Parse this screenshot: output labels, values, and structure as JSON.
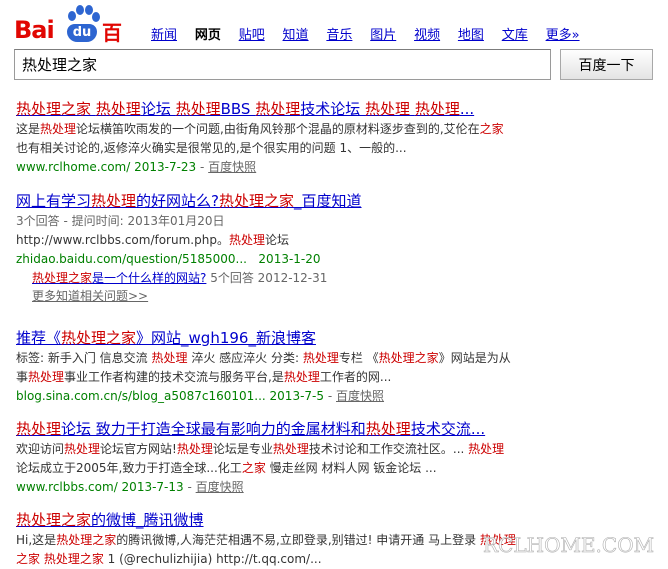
{
  "logo": {
    "bai": "Bai",
    "du": "du",
    "baidu_cn": "百度"
  },
  "nav": [
    "新闻",
    "网页",
    "贴吧",
    "知道",
    "音乐",
    "图片",
    "视频",
    "地图",
    "文库",
    "更多»"
  ],
  "nav_current": "网页",
  "search": {
    "query": "热处理之家",
    "button_label": "百度一下"
  },
  "results": [
    {
      "title": [
        "热处理之家",
        " ",
        "热处理",
        "论坛 ",
        "热处理",
        "BBS ",
        "热处理",
        "技术论坛 ",
        "热处理",
        " ",
        "热处理",
        "..."
      ],
      "abstract_line1": [
        "这是",
        "热处理",
        "论坛横笛吹雨发的一个问题,由街角风铃那个混晶的原材料逐步查到的,艾伦在",
        "之家"
      ],
      "abstract_line2": "也有相关讨论的,返修淬火确实是很常见的,是个很实用的问题 1、一般的...",
      "url": "www.rclhome.com/ 2013-7-23",
      "cache": "百度快照"
    },
    {
      "title": [
        "网上有学习",
        "热处理",
        "的好网站么?",
        "热处理之家",
        "_百度知道"
      ],
      "meta": "3个回答 - 提问时间: 2013年01月20日",
      "link_line": [
        "http://www.rclbbs.com/forum.php。",
        "热处理",
        "论坛"
      ],
      "url": "zhidao.baidu.com/question/5185000...",
      "date": "2013-1-20",
      "sub_q": [
        "热处理之家",
        "是一个什么样的网站?"
      ],
      "sub_meta": "5个回答 2012-12-31",
      "more": "更多知道相关问题>>"
    },
    {
      "title": [
        "推荐《",
        "热处理之家",
        "》网站_wgh196_新浪博客"
      ],
      "abstract_line1": [
        "标签: 新手入门 信息交流 ",
        "热处理",
        " 淬火 感应淬火 分类: ",
        "热处理",
        "专栏 《",
        "热处理之家",
        "》网站是为从"
      ],
      "abstract_line2": [
        "事",
        "热处理",
        "事业工作者构建的技术交流与服务平台,是",
        "热处理",
        "工作者的网..."
      ],
      "url": "blog.sina.com.cn/s/blog_a5087c160101... 2013-7-5",
      "cache": "百度快照"
    },
    {
      "title": [
        "热处理",
        "论坛 致力于打造全球最有影响力的金属材料和",
        "热处理",
        "技术交流..."
      ],
      "abstract_line1": [
        "欢迎访问",
        "热处理",
        "论坛官方网站!",
        "热处理",
        "论坛是专业",
        "热处理",
        "技术讨论和工作交流社区。... ",
        "热处理"
      ],
      "abstract_line2": [
        "论坛成立于2005年,致力于打造全球...化工",
        "之家",
        " 慢走丝网 材料人网 钣金论坛 ..."
      ],
      "url": "www.rclbbs.com/ 2013-7-13",
      "cache": "百度快照"
    },
    {
      "title": [
        "热处理之家",
        "的微博_腾讯微博"
      ],
      "abstract_line1": [
        "Hi,这是",
        "热处理之家",
        "的腾讯微博,人海茫茫相遇不易,立即登录,别错过! 申请开通 马上登录 ",
        "热处理"
      ],
      "abstract_line2": [
        "之家",
        " ",
        "热处理之家",
        " 1 (@rechulizhijia) http://t.qq.com/..."
      ]
    }
  ],
  "watermark": "RCLHOME.COM",
  "colors": {
    "link": "#0000cc",
    "highlight": "#cc0000",
    "url_green": "#008000",
    "grey": "#666666",
    "brand_red": "#e10602",
    "brand_blue": "#2d65d1"
  }
}
